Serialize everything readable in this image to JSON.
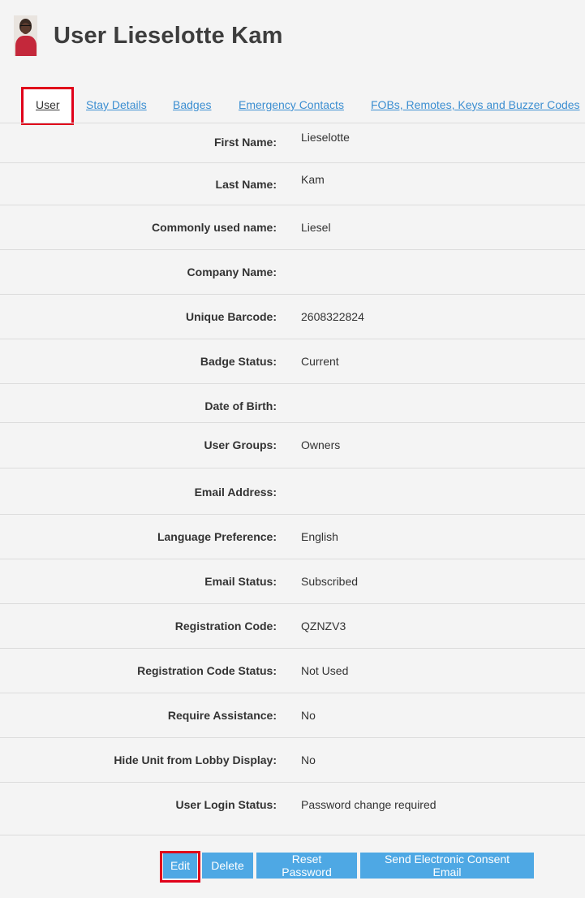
{
  "header": {
    "title": "User Lieselotte Kam"
  },
  "tabs": [
    "User",
    "Stay Details",
    "Badges",
    "Emergency Contacts",
    "FOBs, Remotes, Keys and Buzzer Codes"
  ],
  "fields": [
    {
      "label": "First Name:",
      "value": "Lieselotte"
    },
    {
      "label": "Last Name:",
      "value": "Kam"
    },
    {
      "label": "Commonly used name:",
      "value": "Liesel"
    },
    {
      "label": "Company Name:",
      "value": ""
    },
    {
      "label": "Unique Barcode:",
      "value": "2608322824"
    },
    {
      "label": "Badge Status:",
      "value": "Current"
    },
    {
      "label": "Date of Birth:",
      "value": ""
    },
    {
      "label": "User Groups:",
      "value": "Owners"
    },
    {
      "label": "Email Address:",
      "value": ""
    },
    {
      "label": "Language Preference:",
      "value": "English"
    },
    {
      "label": "Email Status:",
      "value": "Subscribed"
    },
    {
      "label": "Registration Code:",
      "value": "QZNZV3"
    },
    {
      "label": "Registration Code Status:",
      "value": "Not Used"
    },
    {
      "label": "Require Assistance:",
      "value": "No"
    },
    {
      "label": "Hide Unit from Lobby Display:",
      "value": "No"
    },
    {
      "label": "User Login Status:",
      "value": "Password change required"
    }
  ],
  "actions": {
    "edit": "Edit",
    "delete": "Delete",
    "reset_password": "Reset Password",
    "send_consent": "Send Electronic Consent Email"
  },
  "colors": {
    "accent": "#4ea8e4",
    "link": "#3b8ed1",
    "highlight": "#e0001a"
  }
}
